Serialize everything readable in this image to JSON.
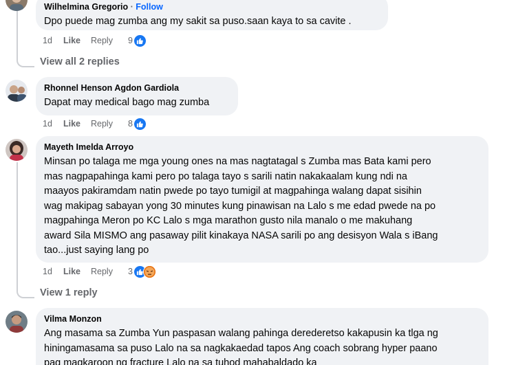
{
  "comments": [
    {
      "author": "Wilhelmina Gregorio",
      "follow_label": "Follow",
      "text_lines": [
        "Dpo puede mag zumba ang my sakit sa puso.saan kaya to sa cavite ."
      ],
      "time": "1d",
      "like_label": "Like",
      "reply_label": "Reply",
      "reaction_count": "9",
      "reactions": [
        "like-icon"
      ],
      "view_replies": "View all 2 replies"
    },
    {
      "author": "Rhonnel Henson Agdon Gardiola",
      "text_lines": [
        "Dapat may medical bago mag zumba"
      ],
      "time": "1d",
      "like_label": "Like",
      "reply_label": "Reply",
      "reaction_count": "8",
      "reactions": [
        "like-icon"
      ]
    },
    {
      "author": "Mayeth Imelda Arroyo",
      "text_lines": [
        "Minsan po talaga me mga young ones na mas nagtatagal s Zumba mas Bata kami pero",
        "mas nagpapahinga kami pero po talaga tayo s sarili natin nakakaalam kung ndi na",
        "maayos pakiramdam natin pwede po tayo tumigil at magpahinga walang dapat sisihin",
        "wag makipag sabayan yong 30 minutes kung pinawisan na Lalo s me edad pwede na po",
        "magpahinga Meron po KC Lalo s mga marathon gusto nila manalo o me makuhang",
        "award Sila MISMO ang pasaway pilit kinakaya NASA sarili po ang desisyon Wala s iBang",
        "tao...just saying lang po"
      ],
      "time": "1d",
      "like_label": "Like",
      "reply_label": "Reply",
      "reaction_count": "3",
      "reactions": [
        "like-icon",
        "angry-icon"
      ],
      "view_replies": "View 1 reply"
    },
    {
      "author": "Vilma Monzon",
      "text_lines": [
        "Ang masama sa Zumba Yun paspasan walang pahinga derederetso kakapusin ka tlga ng",
        "hiningamasama sa puso Lalo na sa nagkakaedad tapos Ang coach sobrang hyper paano",
        "pag magkaroon ng fracture Lalo na sa tuhod mahabaldado ka"
      ]
    }
  ],
  "colors": {
    "bubble": "#f0f2f5",
    "meta": "#65676b",
    "link": "#0866ff",
    "like_reaction": "#1877f2",
    "angry_reaction": "#f0924f"
  }
}
